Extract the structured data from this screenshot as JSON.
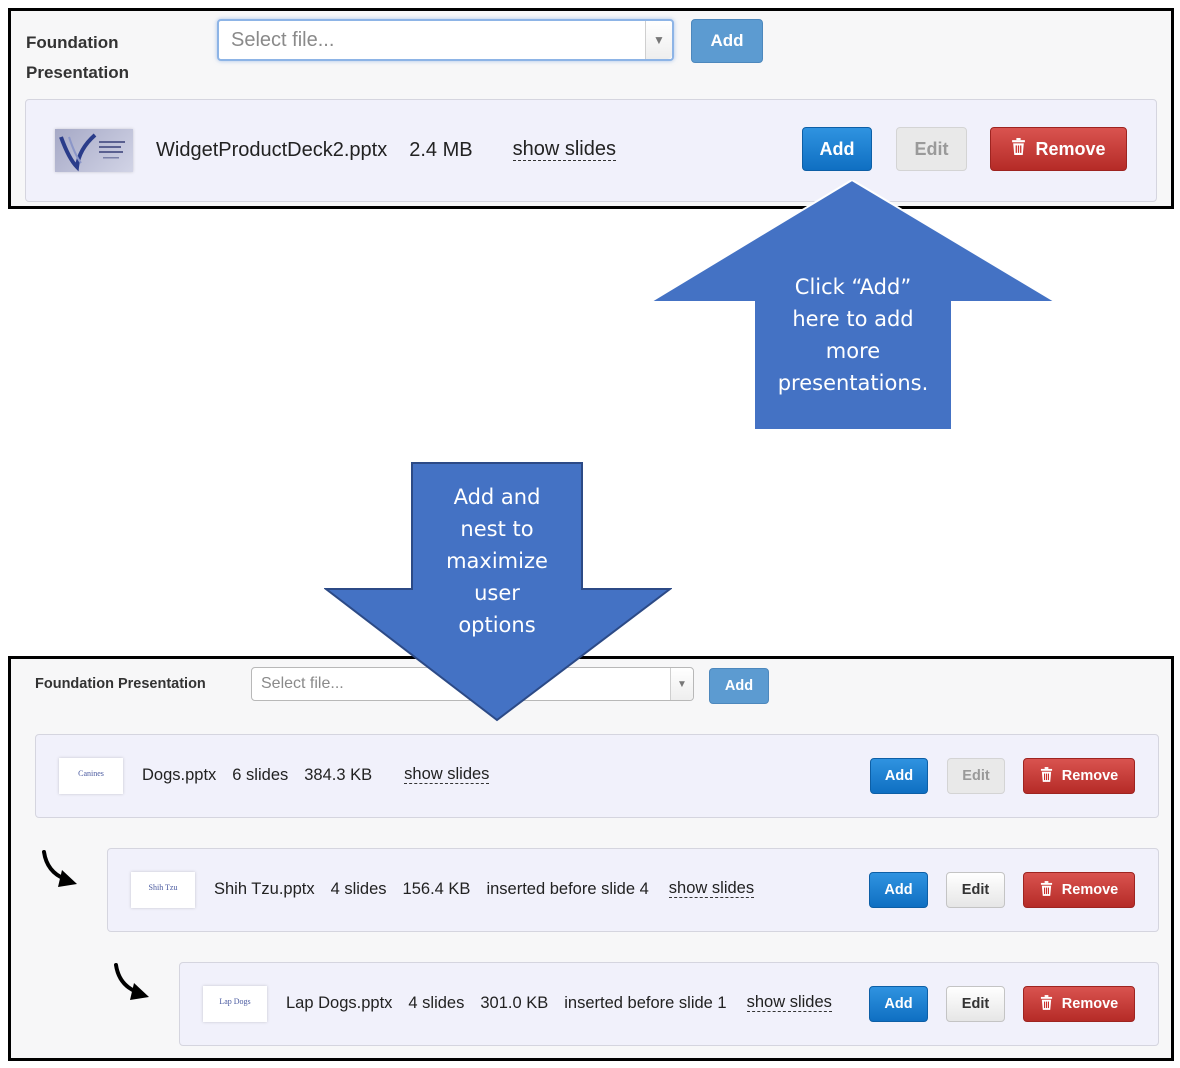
{
  "top_panel": {
    "label": "Foundation Presentation",
    "select_placeholder": "Select file...",
    "add_label": "Add",
    "file": {
      "name": "WidgetProductDeck2.pptx",
      "size": "2.4 MB",
      "show_slides": "show slides",
      "add_label": "Add",
      "edit_label": "Edit",
      "edit_enabled": false,
      "remove_label": "Remove"
    }
  },
  "callouts": {
    "click_add": [
      "Click “Add”",
      "here to add",
      "more",
      "presentations."
    ],
    "nest": [
      "Add and",
      "nest to",
      "maximize",
      "user",
      "options"
    ],
    "color": "#4472c4"
  },
  "bottom_panel": {
    "label": "Foundation Presentation",
    "select_placeholder": "Select file...",
    "add_label": "Add",
    "files": [
      {
        "name": "Dogs.pptx",
        "slides": "6 slides",
        "size": "384.3 KB",
        "inserted": "",
        "show_slides": "show slides",
        "thumb_text": "Canines",
        "add_label": "Add",
        "edit_label": "Edit",
        "edit_enabled": false,
        "remove_label": "Remove"
      },
      {
        "name": "Shih Tzu.pptx",
        "slides": "4 slides",
        "size": "156.4 KB",
        "inserted": "inserted before slide 4",
        "show_slides": "show slides",
        "thumb_text": "Shih Tzu",
        "add_label": "Add",
        "edit_label": "Edit",
        "edit_enabled": true,
        "remove_label": "Remove"
      },
      {
        "name": "Lap Dogs.pptx",
        "slides": "4 slides",
        "size": "301.0 KB",
        "inserted": "inserted before slide 1",
        "show_slides": "show slides",
        "thumb_text": "Lap Dogs",
        "add_label": "Add",
        "edit_label": "Edit",
        "edit_enabled": true,
        "remove_label": "Remove"
      }
    ]
  },
  "colors": {
    "primary_button": "#1a7fd4",
    "light_button": "#5c9bd1",
    "danger_button": "#c9302c",
    "card_background": "#f1f1fb"
  }
}
